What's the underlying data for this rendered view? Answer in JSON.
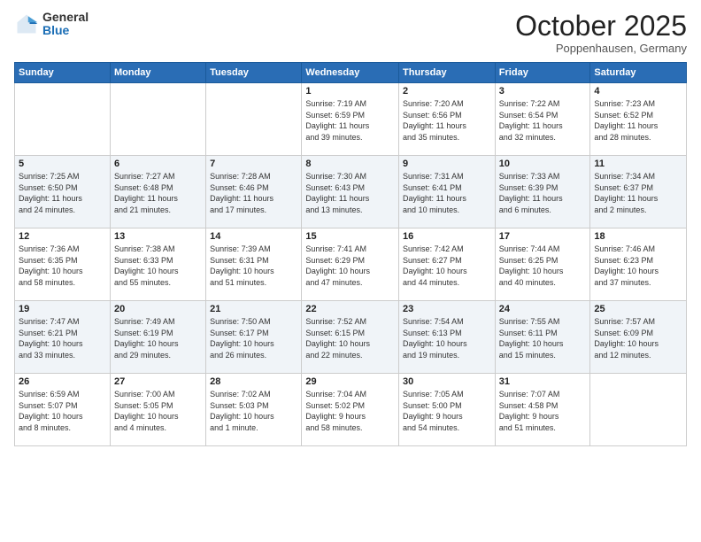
{
  "logo": {
    "general": "General",
    "blue": "Blue"
  },
  "title": "October 2025",
  "subtitle": "Poppenhausen, Germany",
  "days_header": [
    "Sunday",
    "Monday",
    "Tuesday",
    "Wednesday",
    "Thursday",
    "Friday",
    "Saturday"
  ],
  "weeks": [
    {
      "days": [
        {
          "number": "",
          "info": ""
        },
        {
          "number": "",
          "info": ""
        },
        {
          "number": "",
          "info": ""
        },
        {
          "number": "1",
          "info": "Sunrise: 7:19 AM\nSunset: 6:59 PM\nDaylight: 11 hours\nand 39 minutes."
        },
        {
          "number": "2",
          "info": "Sunrise: 7:20 AM\nSunset: 6:56 PM\nDaylight: 11 hours\nand 35 minutes."
        },
        {
          "number": "3",
          "info": "Sunrise: 7:22 AM\nSunset: 6:54 PM\nDaylight: 11 hours\nand 32 minutes."
        },
        {
          "number": "4",
          "info": "Sunrise: 7:23 AM\nSunset: 6:52 PM\nDaylight: 11 hours\nand 28 minutes."
        }
      ]
    },
    {
      "days": [
        {
          "number": "5",
          "info": "Sunrise: 7:25 AM\nSunset: 6:50 PM\nDaylight: 11 hours\nand 24 minutes."
        },
        {
          "number": "6",
          "info": "Sunrise: 7:27 AM\nSunset: 6:48 PM\nDaylight: 11 hours\nand 21 minutes."
        },
        {
          "number": "7",
          "info": "Sunrise: 7:28 AM\nSunset: 6:46 PM\nDaylight: 11 hours\nand 17 minutes."
        },
        {
          "number": "8",
          "info": "Sunrise: 7:30 AM\nSunset: 6:43 PM\nDaylight: 11 hours\nand 13 minutes."
        },
        {
          "number": "9",
          "info": "Sunrise: 7:31 AM\nSunset: 6:41 PM\nDaylight: 11 hours\nand 10 minutes."
        },
        {
          "number": "10",
          "info": "Sunrise: 7:33 AM\nSunset: 6:39 PM\nDaylight: 11 hours\nand 6 minutes."
        },
        {
          "number": "11",
          "info": "Sunrise: 7:34 AM\nSunset: 6:37 PM\nDaylight: 11 hours\nand 2 minutes."
        }
      ]
    },
    {
      "days": [
        {
          "number": "12",
          "info": "Sunrise: 7:36 AM\nSunset: 6:35 PM\nDaylight: 10 hours\nand 58 minutes."
        },
        {
          "number": "13",
          "info": "Sunrise: 7:38 AM\nSunset: 6:33 PM\nDaylight: 10 hours\nand 55 minutes."
        },
        {
          "number": "14",
          "info": "Sunrise: 7:39 AM\nSunset: 6:31 PM\nDaylight: 10 hours\nand 51 minutes."
        },
        {
          "number": "15",
          "info": "Sunrise: 7:41 AM\nSunset: 6:29 PM\nDaylight: 10 hours\nand 47 minutes."
        },
        {
          "number": "16",
          "info": "Sunrise: 7:42 AM\nSunset: 6:27 PM\nDaylight: 10 hours\nand 44 minutes."
        },
        {
          "number": "17",
          "info": "Sunrise: 7:44 AM\nSunset: 6:25 PM\nDaylight: 10 hours\nand 40 minutes."
        },
        {
          "number": "18",
          "info": "Sunrise: 7:46 AM\nSunset: 6:23 PM\nDaylight: 10 hours\nand 37 minutes."
        }
      ]
    },
    {
      "days": [
        {
          "number": "19",
          "info": "Sunrise: 7:47 AM\nSunset: 6:21 PM\nDaylight: 10 hours\nand 33 minutes."
        },
        {
          "number": "20",
          "info": "Sunrise: 7:49 AM\nSunset: 6:19 PM\nDaylight: 10 hours\nand 29 minutes."
        },
        {
          "number": "21",
          "info": "Sunrise: 7:50 AM\nSunset: 6:17 PM\nDaylight: 10 hours\nand 26 minutes."
        },
        {
          "number": "22",
          "info": "Sunrise: 7:52 AM\nSunset: 6:15 PM\nDaylight: 10 hours\nand 22 minutes."
        },
        {
          "number": "23",
          "info": "Sunrise: 7:54 AM\nSunset: 6:13 PM\nDaylight: 10 hours\nand 19 minutes."
        },
        {
          "number": "24",
          "info": "Sunrise: 7:55 AM\nSunset: 6:11 PM\nDaylight: 10 hours\nand 15 minutes."
        },
        {
          "number": "25",
          "info": "Sunrise: 7:57 AM\nSunset: 6:09 PM\nDaylight: 10 hours\nand 12 minutes."
        }
      ]
    },
    {
      "days": [
        {
          "number": "26",
          "info": "Sunrise: 6:59 AM\nSunset: 5:07 PM\nDaylight: 10 hours\nand 8 minutes."
        },
        {
          "number": "27",
          "info": "Sunrise: 7:00 AM\nSunset: 5:05 PM\nDaylight: 10 hours\nand 4 minutes."
        },
        {
          "number": "28",
          "info": "Sunrise: 7:02 AM\nSunset: 5:03 PM\nDaylight: 10 hours\nand 1 minute."
        },
        {
          "number": "29",
          "info": "Sunrise: 7:04 AM\nSunset: 5:02 PM\nDaylight: 9 hours\nand 58 minutes."
        },
        {
          "number": "30",
          "info": "Sunrise: 7:05 AM\nSunset: 5:00 PM\nDaylight: 9 hours\nand 54 minutes."
        },
        {
          "number": "31",
          "info": "Sunrise: 7:07 AM\nSunset: 4:58 PM\nDaylight: 9 hours\nand 51 minutes."
        },
        {
          "number": "",
          "info": ""
        }
      ]
    }
  ]
}
